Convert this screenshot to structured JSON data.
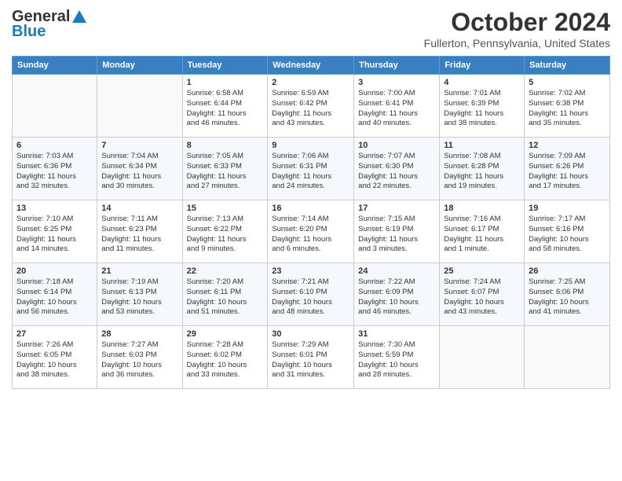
{
  "logo": {
    "line1": "General",
    "line2": "Blue"
  },
  "title": "October 2024",
  "location": "Fullerton, Pennsylvania, United States",
  "days_of_week": [
    "Sunday",
    "Monday",
    "Tuesday",
    "Wednesday",
    "Thursday",
    "Friday",
    "Saturday"
  ],
  "weeks": [
    [
      {
        "day": "",
        "info": ""
      },
      {
        "day": "",
        "info": ""
      },
      {
        "day": "1",
        "info": "Sunrise: 6:58 AM\nSunset: 6:44 PM\nDaylight: 11 hours\nand 46 minutes."
      },
      {
        "day": "2",
        "info": "Sunrise: 6:59 AM\nSunset: 6:42 PM\nDaylight: 11 hours\nand 43 minutes."
      },
      {
        "day": "3",
        "info": "Sunrise: 7:00 AM\nSunset: 6:41 PM\nDaylight: 11 hours\nand 40 minutes."
      },
      {
        "day": "4",
        "info": "Sunrise: 7:01 AM\nSunset: 6:39 PM\nDaylight: 11 hours\nand 38 minutes."
      },
      {
        "day": "5",
        "info": "Sunrise: 7:02 AM\nSunset: 6:38 PM\nDaylight: 11 hours\nand 35 minutes."
      }
    ],
    [
      {
        "day": "6",
        "info": "Sunrise: 7:03 AM\nSunset: 6:36 PM\nDaylight: 11 hours\nand 32 minutes."
      },
      {
        "day": "7",
        "info": "Sunrise: 7:04 AM\nSunset: 6:34 PM\nDaylight: 11 hours\nand 30 minutes."
      },
      {
        "day": "8",
        "info": "Sunrise: 7:05 AM\nSunset: 6:33 PM\nDaylight: 11 hours\nand 27 minutes."
      },
      {
        "day": "9",
        "info": "Sunrise: 7:06 AM\nSunset: 6:31 PM\nDaylight: 11 hours\nand 24 minutes."
      },
      {
        "day": "10",
        "info": "Sunrise: 7:07 AM\nSunset: 6:30 PM\nDaylight: 11 hours\nand 22 minutes."
      },
      {
        "day": "11",
        "info": "Sunrise: 7:08 AM\nSunset: 6:28 PM\nDaylight: 11 hours\nand 19 minutes."
      },
      {
        "day": "12",
        "info": "Sunrise: 7:09 AM\nSunset: 6:26 PM\nDaylight: 11 hours\nand 17 minutes."
      }
    ],
    [
      {
        "day": "13",
        "info": "Sunrise: 7:10 AM\nSunset: 6:25 PM\nDaylight: 11 hours\nand 14 minutes."
      },
      {
        "day": "14",
        "info": "Sunrise: 7:11 AM\nSunset: 6:23 PM\nDaylight: 11 hours\nand 11 minutes."
      },
      {
        "day": "15",
        "info": "Sunrise: 7:13 AM\nSunset: 6:22 PM\nDaylight: 11 hours\nand 9 minutes."
      },
      {
        "day": "16",
        "info": "Sunrise: 7:14 AM\nSunset: 6:20 PM\nDaylight: 11 hours\nand 6 minutes."
      },
      {
        "day": "17",
        "info": "Sunrise: 7:15 AM\nSunset: 6:19 PM\nDaylight: 11 hours\nand 3 minutes."
      },
      {
        "day": "18",
        "info": "Sunrise: 7:16 AM\nSunset: 6:17 PM\nDaylight: 11 hours\nand 1 minute."
      },
      {
        "day": "19",
        "info": "Sunrise: 7:17 AM\nSunset: 6:16 PM\nDaylight: 10 hours\nand 58 minutes."
      }
    ],
    [
      {
        "day": "20",
        "info": "Sunrise: 7:18 AM\nSunset: 6:14 PM\nDaylight: 10 hours\nand 56 minutes."
      },
      {
        "day": "21",
        "info": "Sunrise: 7:19 AM\nSunset: 6:13 PM\nDaylight: 10 hours\nand 53 minutes."
      },
      {
        "day": "22",
        "info": "Sunrise: 7:20 AM\nSunset: 6:11 PM\nDaylight: 10 hours\nand 51 minutes."
      },
      {
        "day": "23",
        "info": "Sunrise: 7:21 AM\nSunset: 6:10 PM\nDaylight: 10 hours\nand 48 minutes."
      },
      {
        "day": "24",
        "info": "Sunrise: 7:22 AM\nSunset: 6:09 PM\nDaylight: 10 hours\nand 46 minutes."
      },
      {
        "day": "25",
        "info": "Sunrise: 7:24 AM\nSunset: 6:07 PM\nDaylight: 10 hours\nand 43 minutes."
      },
      {
        "day": "26",
        "info": "Sunrise: 7:25 AM\nSunset: 6:06 PM\nDaylight: 10 hours\nand 41 minutes."
      }
    ],
    [
      {
        "day": "27",
        "info": "Sunrise: 7:26 AM\nSunset: 6:05 PM\nDaylight: 10 hours\nand 38 minutes."
      },
      {
        "day": "28",
        "info": "Sunrise: 7:27 AM\nSunset: 6:03 PM\nDaylight: 10 hours\nand 36 minutes."
      },
      {
        "day": "29",
        "info": "Sunrise: 7:28 AM\nSunset: 6:02 PM\nDaylight: 10 hours\nand 33 minutes."
      },
      {
        "day": "30",
        "info": "Sunrise: 7:29 AM\nSunset: 6:01 PM\nDaylight: 10 hours\nand 31 minutes."
      },
      {
        "day": "31",
        "info": "Sunrise: 7:30 AM\nSunset: 5:59 PM\nDaylight: 10 hours\nand 28 minutes."
      },
      {
        "day": "",
        "info": ""
      },
      {
        "day": "",
        "info": ""
      }
    ]
  ]
}
